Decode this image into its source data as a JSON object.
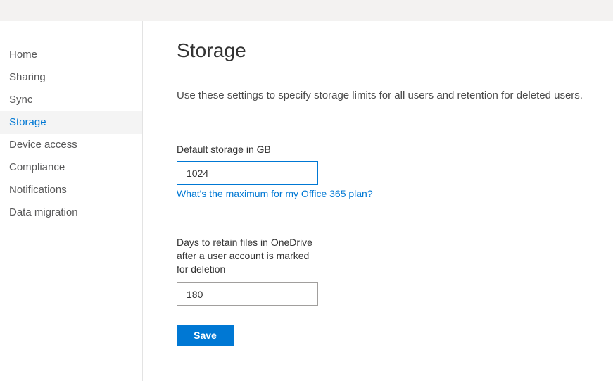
{
  "topbar": {
    "background": "#f3f2f1"
  },
  "colors": {
    "accent": "#0078d4",
    "selected_nav_background": "#f4f4f4",
    "nav_text": "#59595a",
    "body_text": "#333333",
    "input_border": "#a19f9d",
    "focused_input_border": "#0078d4"
  },
  "sidebar": {
    "items": [
      {
        "label": "Home",
        "selected": false
      },
      {
        "label": "Sharing",
        "selected": false
      },
      {
        "label": "Sync",
        "selected": false
      },
      {
        "label": "Storage",
        "selected": true
      },
      {
        "label": "Device access",
        "selected": false
      },
      {
        "label": "Compliance",
        "selected": false
      },
      {
        "label": "Notifications",
        "selected": false
      },
      {
        "label": "Data migration",
        "selected": false
      }
    ]
  },
  "main": {
    "title": "Storage",
    "description": "Use these settings to specify storage limits for all users and retention for deleted users.",
    "fields": {
      "default_storage": {
        "label": "Default storage in GB",
        "value": "1024",
        "placeholder": "",
        "focused": true,
        "help_link": "What's the maximum for my Office 365 plan?"
      },
      "retention_days": {
        "label": "Days to retain files in OneDrive after a user account is marked for deletion",
        "value": "180",
        "placeholder": "",
        "focused": false
      }
    },
    "save_label": "Save"
  }
}
